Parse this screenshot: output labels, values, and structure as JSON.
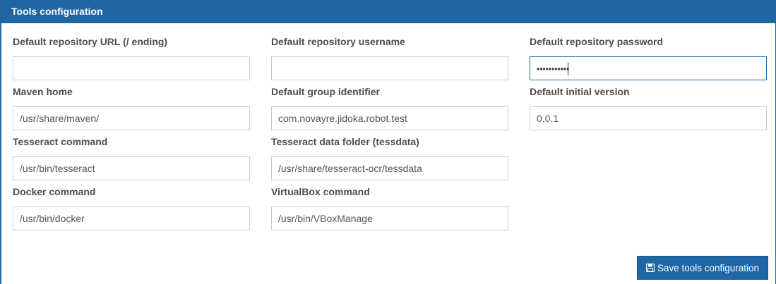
{
  "panel": {
    "title": "Tools configuration"
  },
  "fields": {
    "repo_url": {
      "label": "Default repository URL (/ ending)",
      "value": ""
    },
    "repo_username": {
      "label": "Default repository username",
      "value": ""
    },
    "repo_password": {
      "label": "Default repository password",
      "value": "•••••••••••"
    },
    "maven_home": {
      "label": "Maven home",
      "value": "/usr/share/maven/"
    },
    "group_id": {
      "label": "Default group identifier",
      "value": "com.novayre.jidoka.robot.test"
    },
    "initial_version": {
      "label": "Default initial version",
      "value": "0.0.1"
    },
    "tesseract_cmd": {
      "label": "Tesseract command",
      "value": "/usr/bin/tesseract"
    },
    "tessdata_folder": {
      "label": "Tesseract data folder (tessdata)",
      "value": "/usr/share/tesseract-ocr/tessdata"
    },
    "docker_cmd": {
      "label": "Docker command",
      "value": "/usr/bin/docker"
    },
    "virtualbox_cmd": {
      "label": "VirtualBox command",
      "value": "/usr/bin/VBoxManage"
    }
  },
  "actions": {
    "save_label": "Save tools configuration",
    "save_icon": "floppy-disk-icon"
  },
  "colors": {
    "header": "#1f66a4",
    "button": "#1f66a4"
  }
}
